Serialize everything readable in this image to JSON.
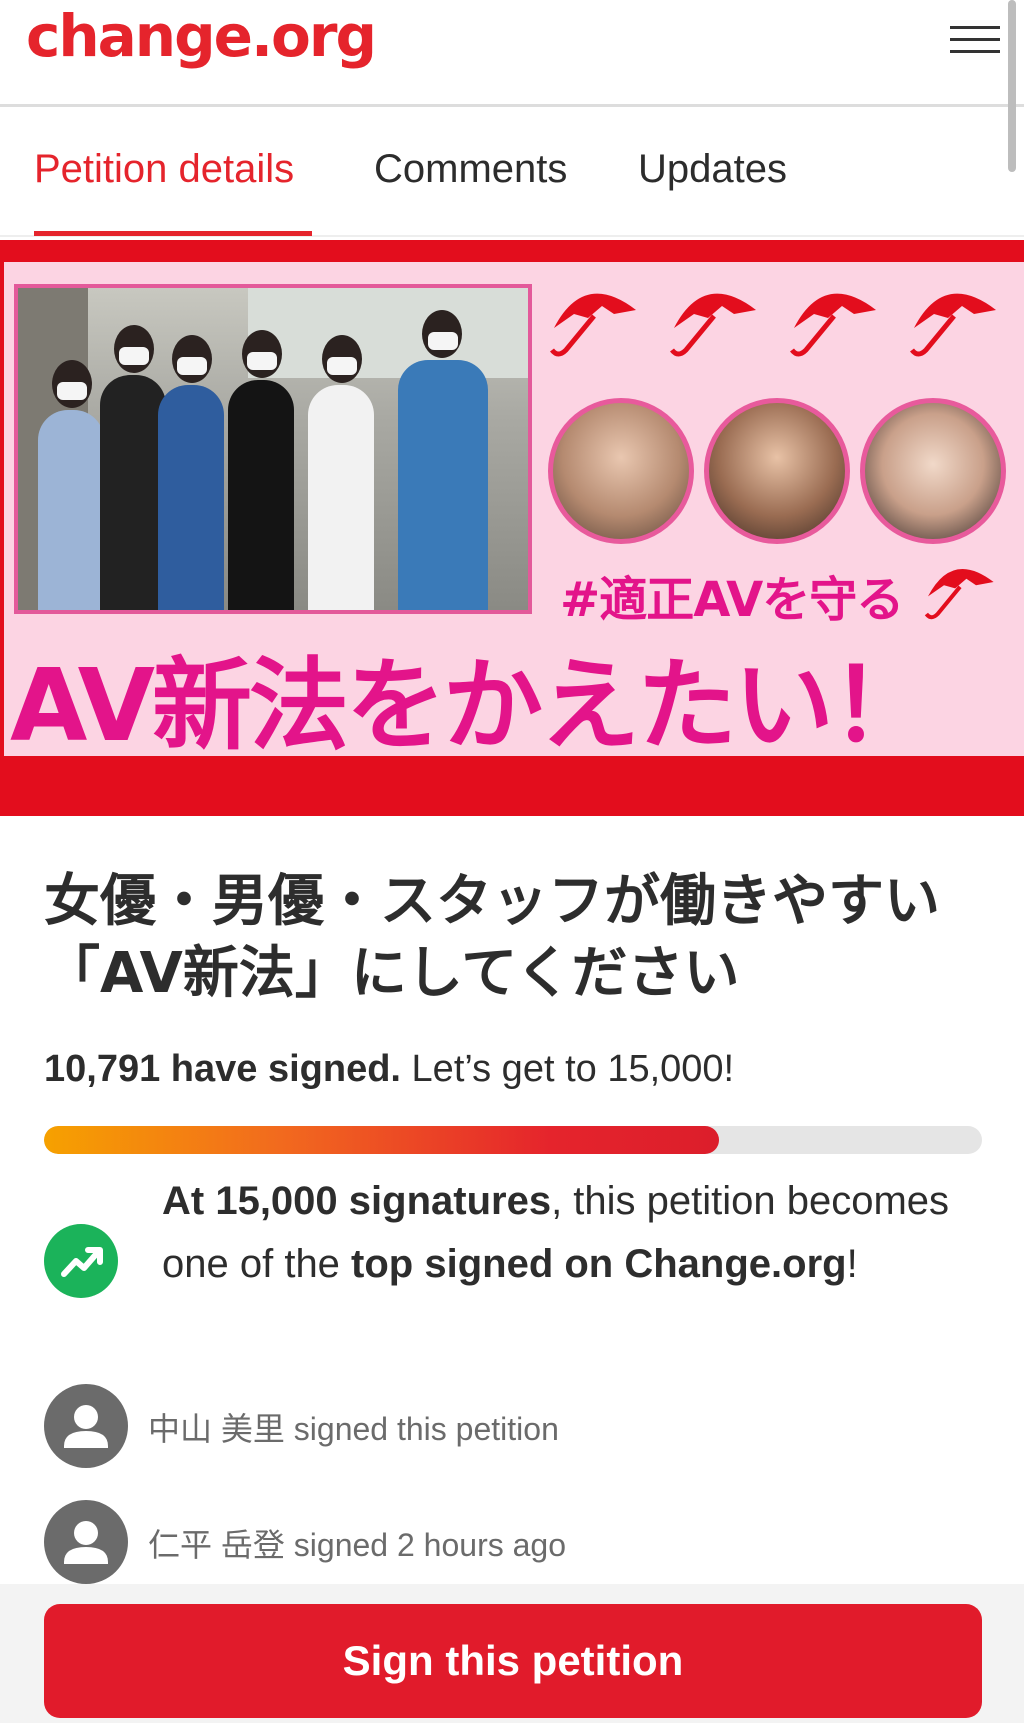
{
  "app": {
    "logo": "change.org"
  },
  "tabs": [
    {
      "label": "Petition details",
      "active": true
    },
    {
      "label": "Comments",
      "active": false
    },
    {
      "label": "Updates",
      "active": false
    }
  ],
  "banner": {
    "hashtag": "#適正AVを守る",
    "headline": "AV新法をかえたい！",
    "colors": {
      "red": "#e30d1d",
      "pink": "#fcd4e3",
      "magenta": "#e3148a"
    }
  },
  "petition": {
    "title": "女優・男優・スタッフが働きやすい「AV新法」にしてください",
    "signed_count": "10,791 have signed.",
    "goal_text": "Let’s get to 15,000!",
    "progress": 0.7194,
    "milestone": {
      "icon": "trending-up-icon",
      "bold1": "At 15,000 signatures",
      "text1": ", this petition becomes one of the ",
      "bold2": "top signed on Change.org",
      "text2": "!"
    }
  },
  "signers": [
    {
      "name": "中山 美里",
      "action": "signed this petition"
    },
    {
      "name": "仁平 岳登",
      "action": "signed 2 hours ago"
    }
  ],
  "footer": {
    "sign_button": "Sign this petition"
  },
  "colors": {
    "brand": "#e5242c",
    "milestone_green": "#1bb35a",
    "button": "#e11b2b"
  }
}
